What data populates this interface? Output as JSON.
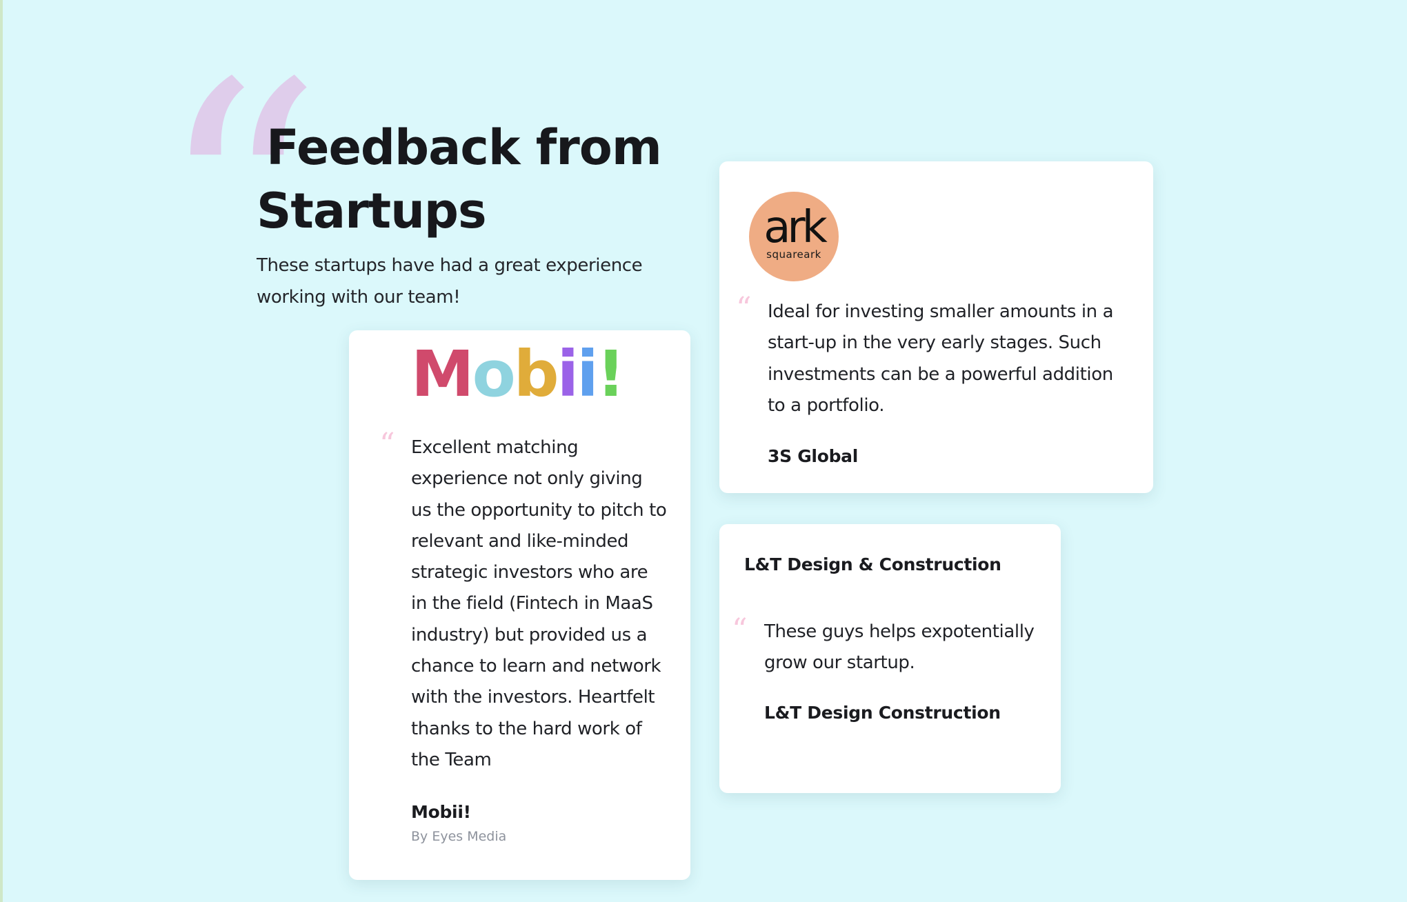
{
  "section": {
    "title_line1": "Feedback from",
    "title_line2": "Startups",
    "subtitle": "These startups have had a great experience working with our team!",
    "quote_glyph": "“"
  },
  "testimonials": [
    {
      "logo_text": [
        "M",
        "o",
        "b",
        "i",
        "i",
        "!"
      ],
      "logo_colors": [
        "#d04a6c",
        "#8fd3df",
        "#e0ac3a",
        "#9b63e8",
        "#5fa0ee",
        "#6ad15a"
      ],
      "quote": "Excellent matching experience not only giving us the opportunity to pitch to relevant and like-minded strategic investors who are in the field (Fintech in MaaS industry) but provided us a chance to learn and network with the investors.  Heartfelt thanks to the hard work of the Team",
      "author": "Mobii!",
      "byline": "By Eyes Media"
    },
    {
      "logo_word": "ark",
      "logo_sub": "squareark",
      "logo_color": "#efac84",
      "quote": "Ideal for investing smaller amounts in a start-up in the very early stages. Such investments can be a powerful addition to a portfolio.",
      "author": "3S Global"
    },
    {
      "company": "L&T Design & Construction",
      "quote": "These guys helps expotentially grow our startup.",
      "author": "L&T Design Construction"
    }
  ],
  "colors": {
    "background": "#dbf8fb",
    "card": "#ffffff",
    "quote_mark": "#f7c7dc",
    "big_quote": "#dfcdeb"
  }
}
